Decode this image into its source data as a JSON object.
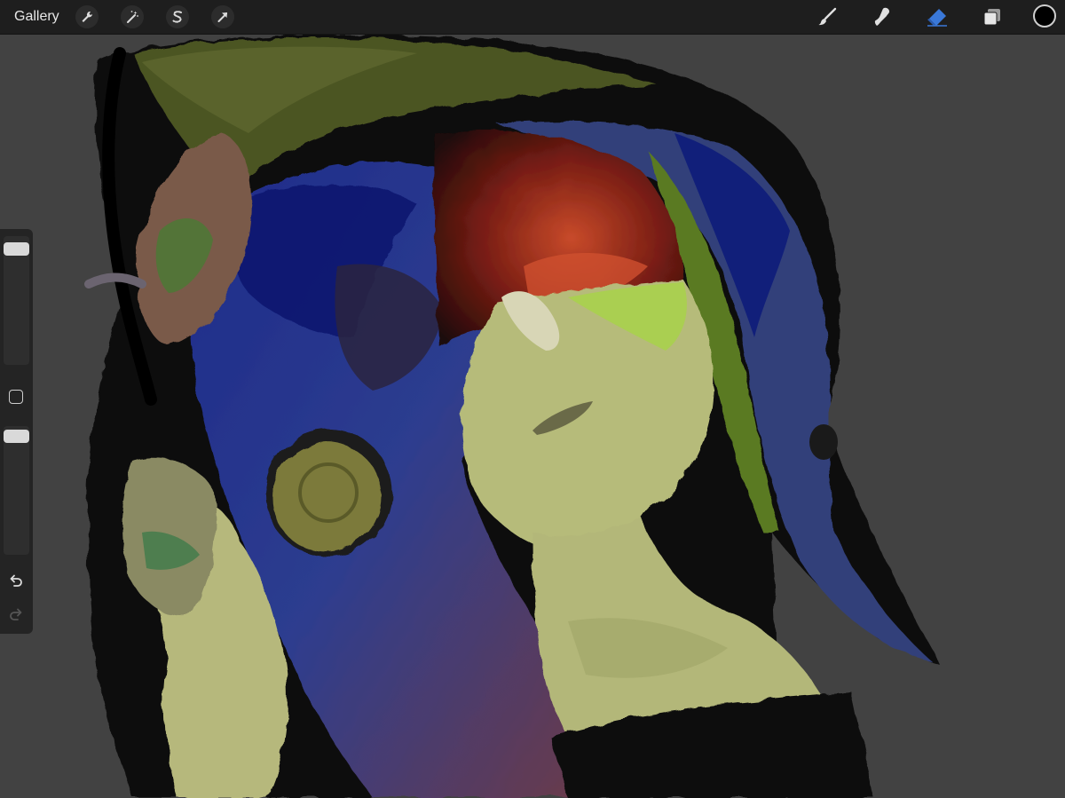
{
  "topbar": {
    "gallery_label": "Gallery",
    "left_tools": [
      "actions-wrench-icon",
      "adjustments-wand-icon",
      "selection-s-icon",
      "transform-arrow-icon"
    ],
    "right_tools": [
      "brush-icon",
      "smudge-icon",
      "eraser-icon",
      "layers-icon"
    ],
    "active_tool": "eraser-icon",
    "active_color": "#3a78d8",
    "current_color": "#000000"
  },
  "sidebar": {
    "brush_size_level": 0.95,
    "opacity_level": 0.95,
    "undo_icon": "undo-arrow-icon",
    "redo_icon": "redo-arrow-icon"
  },
  "canvas": {
    "background_color": "#424242"
  }
}
